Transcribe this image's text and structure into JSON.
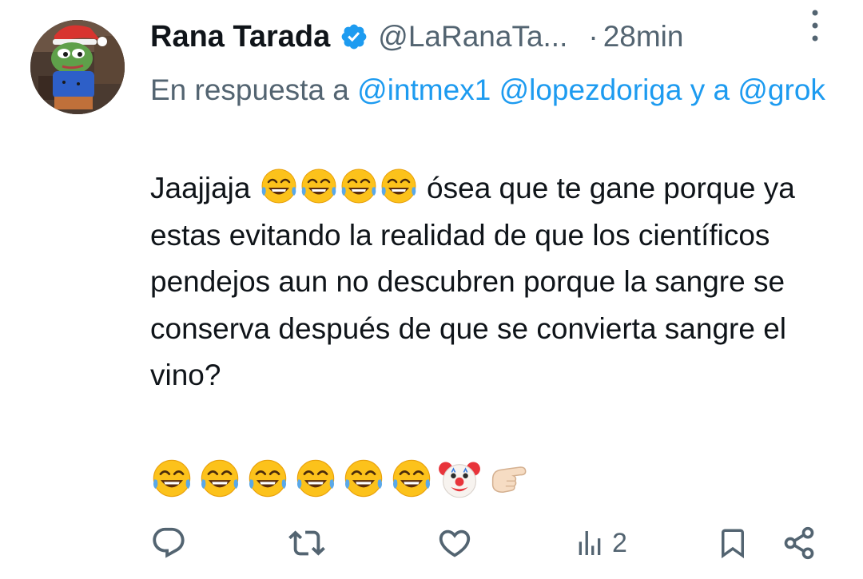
{
  "tweet": {
    "display_name": "Rana Tarada",
    "handle": "@LaRanaTa...",
    "separator": "·",
    "time": "28min",
    "reply_prefix": "En respuesta a",
    "reply_mention_1": "@intmex1",
    "reply_mention_2": "@lopezdoriga",
    "reply_conj": "y a",
    "reply_mention_3": "@grok",
    "text_part1": "Jaajjaja",
    "text_part2": "ósea que te gane porque ya estas evitando la realidad de que los científicos pendejos aun no descubren porque la sangre se conserva después de que se convierta sangre el vino?",
    "emoji_line": [
      "joy",
      "joy",
      "joy",
      "joy",
      "joy",
      "joy",
      "clown",
      "pointing"
    ],
    "actions": {
      "views_count": "2"
    }
  },
  "colors": {
    "accent": "#1d9bf0",
    "secondary_text": "#536471",
    "primary_text": "#0f1419"
  },
  "icons": [
    "verified-badge-icon",
    "more-icon",
    "reply-icon",
    "retweet-icon",
    "like-icon",
    "views-icon",
    "bookmark-icon",
    "share-icon"
  ]
}
